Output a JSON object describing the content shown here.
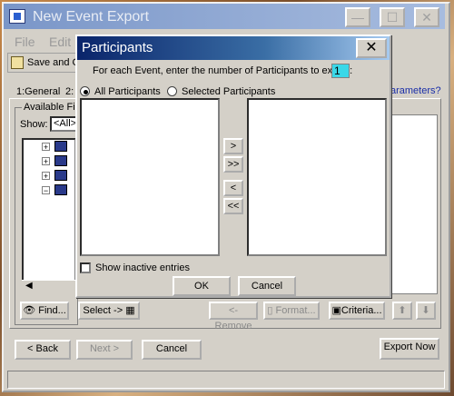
{
  "main_window": {
    "title": "New Event Export",
    "controls": {
      "minimize": "—",
      "maximize": "☐",
      "close": "✕"
    },
    "menu": [
      "File",
      "Edit"
    ],
    "toolbar": {
      "save_label": "Save and C"
    },
    "tabs": [
      "1:General",
      "2:"
    ],
    "available_fields_label": "Available Fie",
    "show_label": "Show:",
    "show_value": "<All>",
    "parameters_link": "arameters?",
    "buttons": {
      "find": "Find...",
      "select": "Select ->",
      "remove": "<-Remove",
      "format": "Format...",
      "criteria": "Criteria...",
      "back": "< Back",
      "next": "Next >",
      "cancel": "Cancel",
      "export_now": "Export Now"
    },
    "up_glyph": "⬆",
    "down_glyph": "⬇"
  },
  "dialog": {
    "title": "Participants",
    "close_glyph": "✕",
    "prompt": "For each Event, enter the number of Participants to export:",
    "count_value": "1",
    "radio_all": "All Participants",
    "radio_selected": "Selected Participants",
    "radio_all_checked": true,
    "arrows": {
      "add": ">",
      "add_all": ">>",
      "remove": "<",
      "remove_all": "<<"
    },
    "checkbox_label": "Show inactive entries",
    "ok": "OK",
    "cancel": "Cancel"
  },
  "icons": [
    "app-icon",
    "save-icon",
    "binoculars-icon",
    "select-icon",
    "criteria-icon",
    "format-icon"
  ]
}
